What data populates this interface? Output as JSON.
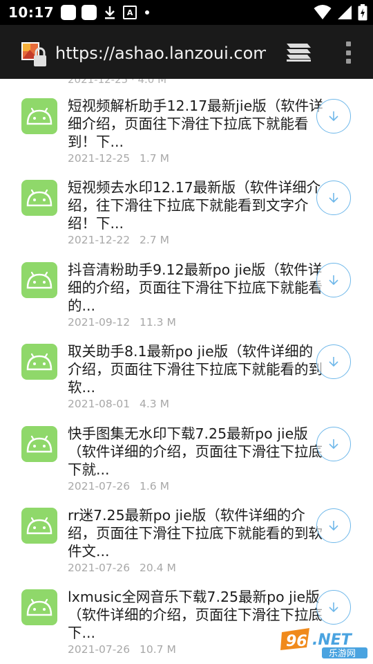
{
  "status_bar": {
    "time": "10:17"
  },
  "browser": {
    "url": "https://ashao.lanzoui.com",
    "icons": [
      "site-icon",
      "tabs-icon",
      "overflow-menu-icon"
    ]
  },
  "partial_row": "2021-12-25 · 4.0 M",
  "files": [
    {
      "title": "短视频解析助手12.17最新jie版（软件详细介绍，页面往下滑往下拉底下就能看到！下...",
      "date": "2021-12-25",
      "size": "1.7 M"
    },
    {
      "title": "短视频去水印12.17最新版（软件详细介绍，往下滑往下拉底下就能看到文字介绍！下...",
      "date": "2021-12-22",
      "size": "2.7 M"
    },
    {
      "title": "抖音清粉助手9.12最新po jie版（软件详细的介绍，页面往下滑往下拉底下就能看的...",
      "date": "2021-09-12",
      "size": "11.3 M"
    },
    {
      "title": "取关助手8.1最新po jie版（软件详细的介绍，页面往下滑往下拉底下就能看的到软...",
      "date": "2021-08-01",
      "size": "4.3 M"
    },
    {
      "title": "快手图集无水印下载7.25最新po jie版（软件详细的介绍，页面往下滑往下拉底下就...",
      "date": "2021-07-26",
      "size": "1.6 M"
    },
    {
      "title": "rr迷7.25最新po jie版（软件详细的介绍，页面往下滑往下拉底下就能看的到软件文...",
      "date": "2021-07-26",
      "size": "20.4 M"
    },
    {
      "title": "lxmusic全网音乐下载7.25最新po jie版（软件详细的介绍，页面往下滑往下拉底下...",
      "date": "2021-07-26",
      "size": "10.7 M"
    }
  ],
  "watermark": {
    "top": "962.NET",
    "bottom": "乐游网"
  },
  "colors": {
    "status_bg": "#000000",
    "toolbar_bg": "#1a1a1a",
    "android_green": "#8fd86a",
    "download_blue": "#6fb8ea",
    "meta_gray": "#a8a8a8"
  }
}
